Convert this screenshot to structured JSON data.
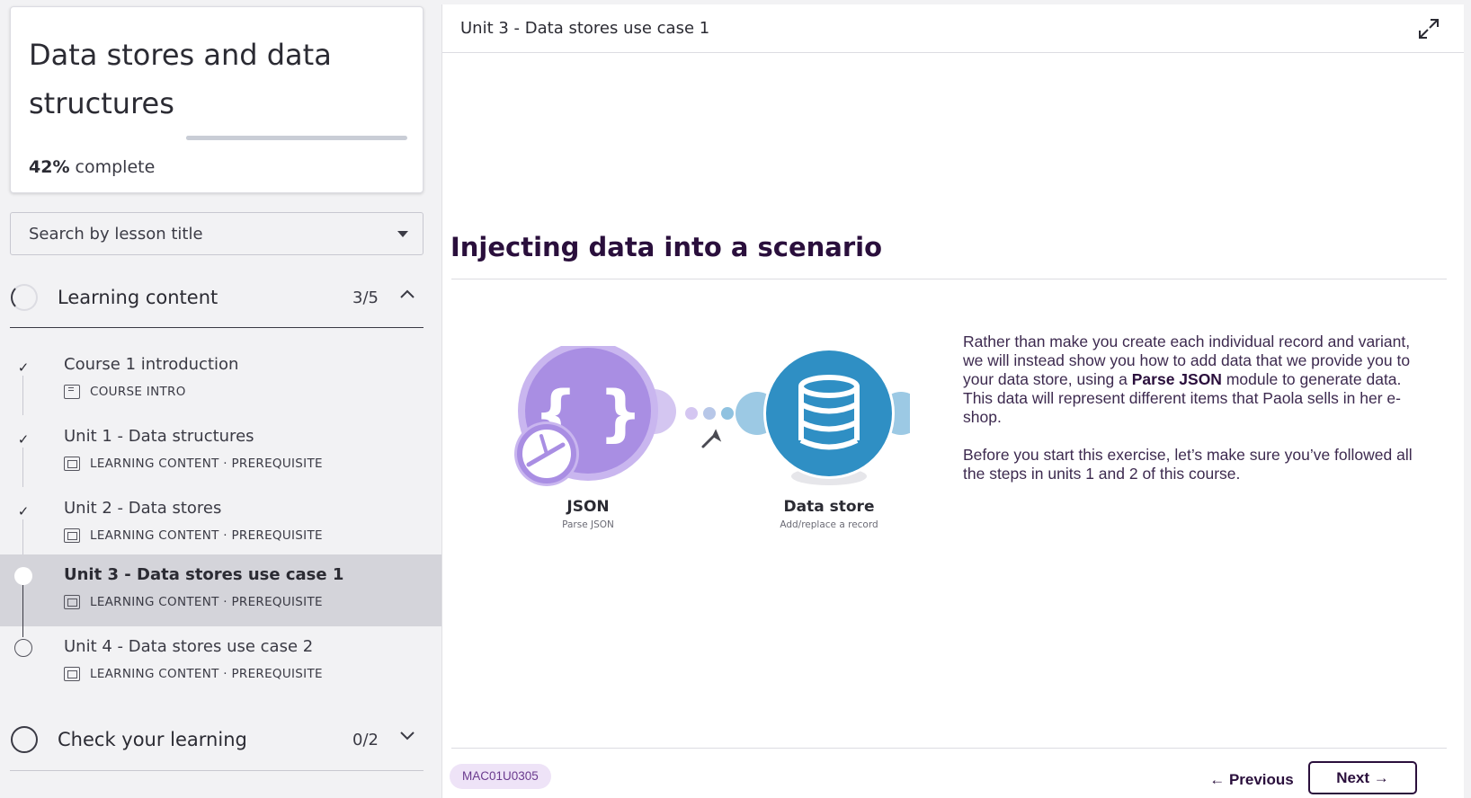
{
  "course": {
    "title": "Data stores and data structures",
    "progress_percent": 42,
    "progress_value": "42%",
    "progress_suffix": "complete"
  },
  "search": {
    "value": "Search by lesson title"
  },
  "sections": [
    {
      "label": "Learning content",
      "count": "3/5",
      "expanded": true,
      "lessons": [
        {
          "title": "Course 1 introduction",
          "meta": "COURSE INTRO",
          "status": "done",
          "icon": "document-icon"
        },
        {
          "title": "Unit 1 - Data structures",
          "meta": "LEARNING CONTENT · PREREQUISITE",
          "status": "done",
          "icon": "slides-icon"
        },
        {
          "title": "Unit 2 - Data stores",
          "meta": "LEARNING CONTENT · PREREQUISITE",
          "status": "done",
          "icon": "slides-icon"
        },
        {
          "title": "Unit 3 - Data stores use case 1",
          "meta": "LEARNING CONTENT · PREREQUISITE",
          "status": "current",
          "icon": "slides-icon"
        },
        {
          "title": "Unit 4 - Data stores use case 2",
          "meta": "LEARNING CONTENT · PREREQUISITE",
          "status": "todo",
          "icon": "slides-icon"
        }
      ]
    },
    {
      "label": "Check your learning",
      "count": "0/2",
      "expanded": false
    }
  ],
  "main": {
    "header_title": "Unit 3 - Data stores use case 1",
    "heading": "Injecting data into a scenario",
    "diagram": {
      "module1_title": "JSON",
      "module1_subtitle": "Parse JSON",
      "module2_title": "Data store",
      "module2_subtitle": "Add/replace a record"
    },
    "paragraph1_pre": "Rather than make you create each individual record and variant, we will instead show you how to add data that we provide you to your data store, using a ",
    "paragraph1_bold": "Parse JSON",
    "paragraph1_post": " module to generate data. This data will represent different items that Paola sells in her e-shop.",
    "paragraph2": "Before you start this exercise, let’s make sure you’ve followed all the steps in units 1 and 2 of this course.",
    "code": "MAC01U0305",
    "prev_label": "← Previous",
    "next_label": "Next →"
  },
  "colors": {
    "accent": "#2a0f3c",
    "json_purple": "#a98ee3",
    "datastore_blue": "#2f8fc4",
    "badge_bg": "#eee3f7"
  }
}
